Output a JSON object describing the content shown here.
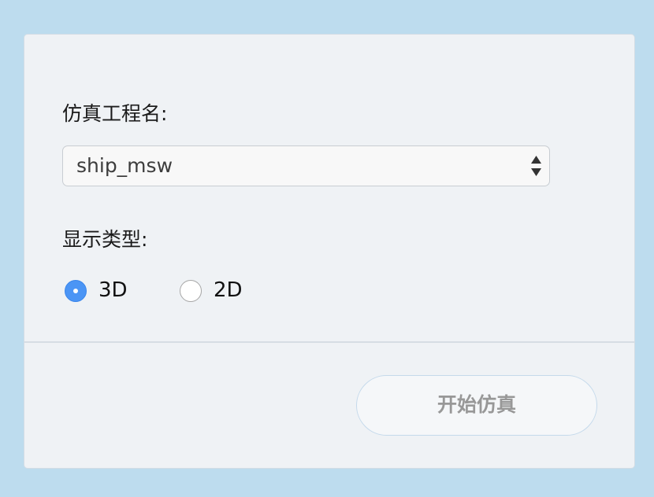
{
  "form": {
    "project_label": "仿真工程名:",
    "project_select": {
      "selected": "ship_msw"
    },
    "display_label": "显示类型:",
    "display_options": [
      {
        "label": "3D",
        "checked": true
      },
      {
        "label": "2D",
        "checked": false
      }
    ]
  },
  "footer": {
    "start_button_label": "开始仿真"
  },
  "colors": {
    "page_background": "#bddcee",
    "card_background": "#eff2f5",
    "radio_accent": "#4b95f5",
    "button_text": "#989898"
  },
  "icons": {
    "select_arrows": "up-down-caret-icon",
    "radio_selected": "radio-selected-icon",
    "radio_unselected": "radio-unselected-icon"
  }
}
